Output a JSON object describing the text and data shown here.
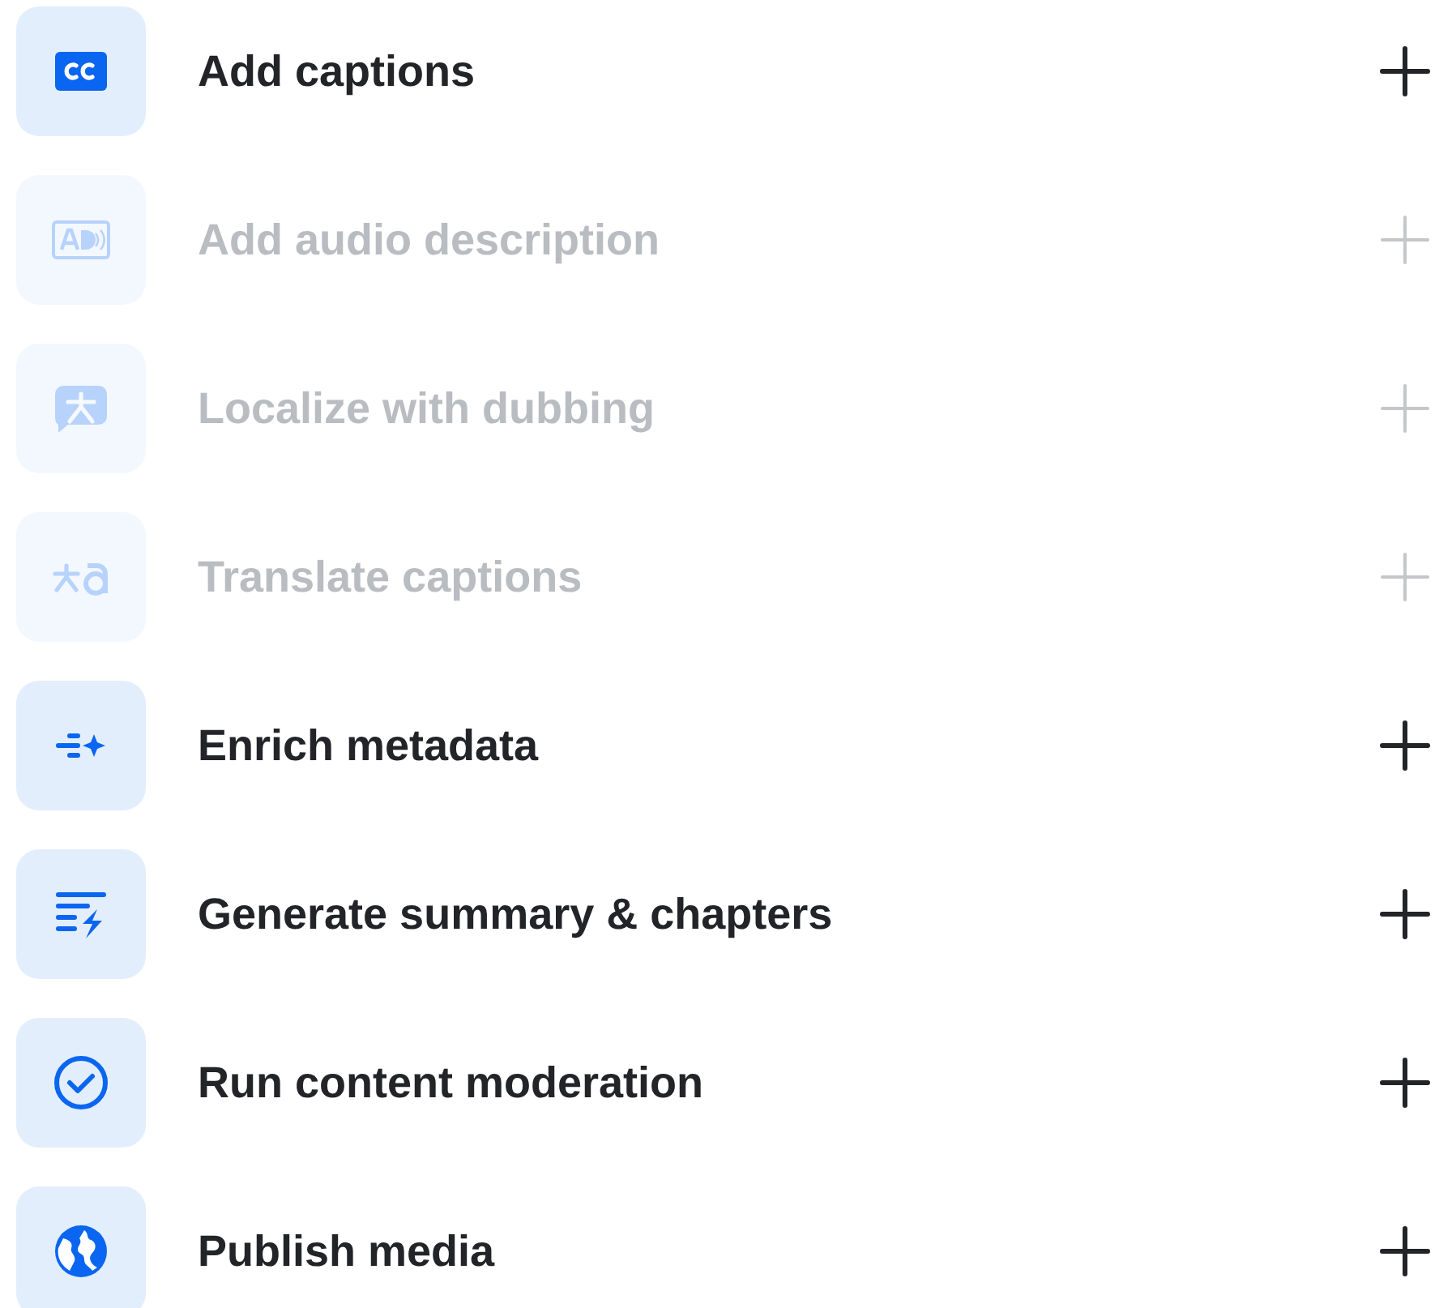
{
  "actions": [
    {
      "kind": "captions",
      "label": "Add captions",
      "disabled": false
    },
    {
      "kind": "audio",
      "label": "Add audio description",
      "disabled": true
    },
    {
      "kind": "dubbing",
      "label": "Localize with dubbing",
      "disabled": true
    },
    {
      "kind": "translate",
      "label": "Translate captions",
      "disabled": true
    },
    {
      "kind": "metadata",
      "label": "Enrich metadata",
      "disabled": false
    },
    {
      "kind": "summary",
      "label": "Generate summary & chapters",
      "disabled": false
    },
    {
      "kind": "moderation",
      "label": "Run content moderation",
      "disabled": false
    },
    {
      "kind": "publish",
      "label": "Publish media",
      "disabled": false
    }
  ]
}
